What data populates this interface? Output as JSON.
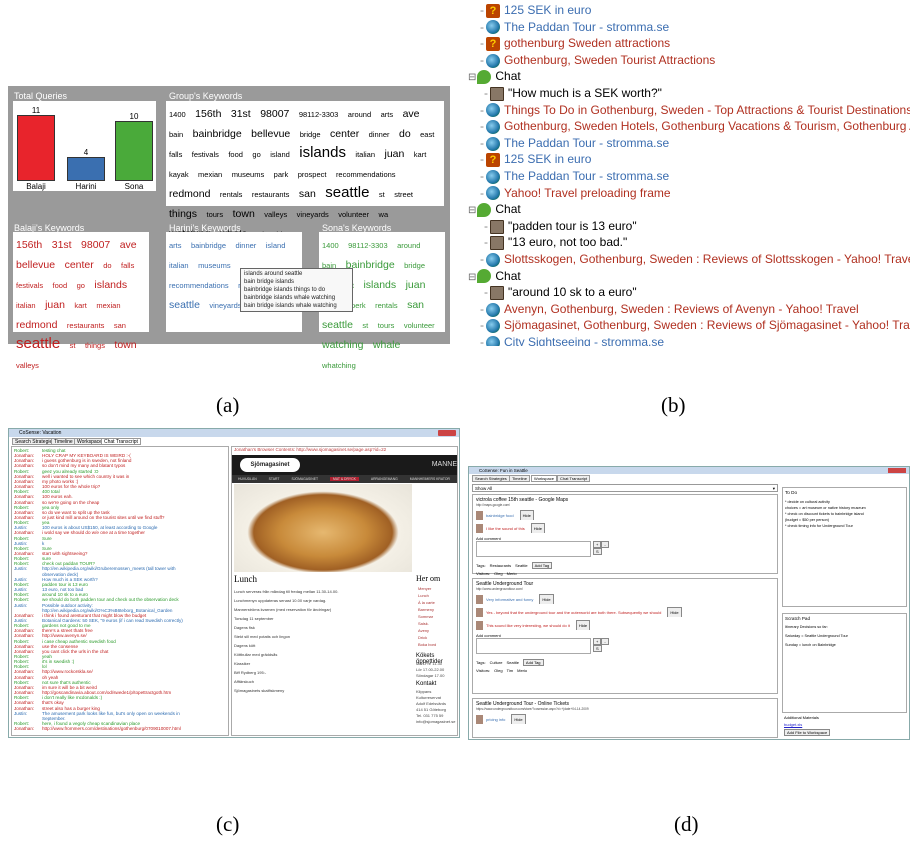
{
  "captions": [
    "(a)",
    "(b)",
    "(c)",
    "(d)"
  ],
  "panel_a": {
    "total_title": "Total Queries",
    "group_title": "Group's Keywords",
    "balaji_title": "Balaji's Keywords",
    "harini_title": "Harini's Keywords",
    "sona_title": "Sona's Keywords",
    "bars": [
      {
        "name": "Balaji",
        "value": "11",
        "color": "#e8242c"
      },
      {
        "name": "Harini",
        "value": "4",
        "color": "#3a6fb0"
      },
      {
        "name": "Sona",
        "value": "10",
        "color": "#4aaa3a"
      }
    ],
    "group_words": [
      "1400",
      "156th",
      "31st",
      "98007",
      "98112-3303",
      "around",
      "arts",
      "ave",
      "bain",
      "bainbridge",
      "bellevue",
      "bridge",
      "center",
      "dinner",
      "do",
      "east",
      "falls",
      "festivals",
      "food",
      "go",
      "island",
      "islands",
      "italian",
      "juan",
      "kart",
      "kayak",
      "mexian",
      "museums",
      "park",
      "prospect",
      "recommendations",
      "redmond",
      "rentals",
      "restaurants",
      "san",
      "seattle",
      "st",
      "street",
      "things",
      "tours",
      "town",
      "valleys",
      "vineyards",
      "volunteer",
      "wa",
      "watching",
      "whale",
      "whatching"
    ],
    "balaji_words": [
      "156th",
      "31st",
      "98007",
      "ave",
      "bellevue",
      "center",
      "do",
      "falls",
      "festivals",
      "food",
      "go",
      "islands",
      "italian",
      "juan",
      "kart",
      "mexian",
      "redmond",
      "restaurants",
      "san",
      "seattle",
      "st",
      "things",
      "town",
      "valleys"
    ],
    "harini_words": [
      "arts",
      "bainbridge",
      "dinner",
      "island",
      "italian",
      "museums",
      "recommendations",
      "restaurants",
      "seattle",
      "vineyards",
      "winery"
    ],
    "sona_words": [
      "1400",
      "98112-3303",
      "around",
      "bain",
      "bainbridge",
      "bridge",
      "do",
      "east",
      "islands",
      "juan",
      "kayak",
      "perk",
      "rentals",
      "san",
      "seattle",
      "st",
      "tours",
      "volunteer",
      "watching",
      "whale",
      "whatching"
    ],
    "tooltip": [
      "islands around seattle",
      "bain bridge islands",
      "bainbridge islands things to do",
      "bainbridge islands whale watching",
      "bain bridge islands whale watching"
    ]
  },
  "panel_b": {
    "rows": [
      {
        "icon": "q",
        "text": "125 SEK in euro",
        "color": "blue",
        "indent": 1
      },
      {
        "icon": "e",
        "text": "The Paddan Tour - stromma.se",
        "color": "blue",
        "indent": 1
      },
      {
        "icon": "q",
        "text": "gothenburg Sweden attractions",
        "color": "red",
        "indent": 1
      },
      {
        "icon": "e",
        "text": "Gothenburg, Sweden Tourist Attractions",
        "color": "red",
        "indent": 1
      },
      {
        "icon": "c",
        "text": "Chat",
        "color": "black",
        "indent": 0
      },
      {
        "icon": "u",
        "text": "\"How much is a SEK worth?\"",
        "color": "black",
        "indent": 2
      },
      {
        "icon": "e",
        "text": "Things To Do in Gothenburg, Sweden - Top Attractions & Tourist Destinations In G",
        "color": "red",
        "indent": 1
      },
      {
        "icon": "e",
        "text": "Gothenburg, Sweden Hotels, Gothenburg Vacations & Tourism, Gothenburg Attra",
        "color": "red",
        "indent": 1
      },
      {
        "icon": "e",
        "text": "The Paddan Tour - stromma.se",
        "color": "blue",
        "indent": 1
      },
      {
        "icon": "q",
        "text": "125 SEK in euro",
        "color": "blue",
        "indent": 1
      },
      {
        "icon": "e",
        "text": "The Paddan Tour - stromma.se",
        "color": "blue",
        "indent": 1
      },
      {
        "icon": "e",
        "text": "Yahoo! Travel preloading frame",
        "color": "red",
        "indent": 1
      },
      {
        "icon": "c",
        "text": "Chat",
        "color": "black",
        "indent": 0
      },
      {
        "icon": "u",
        "text": "\"padden tour is 13 euro\"",
        "color": "black",
        "indent": 2
      },
      {
        "icon": "u",
        "text": "\"13 euro, not too bad.\"",
        "color": "black",
        "indent": 2
      },
      {
        "icon": "e",
        "text": "Slottsskogen, Gothenburg, Sweden : Reviews of Slottsskogen - Yahoo! Travel",
        "color": "red",
        "indent": 1
      },
      {
        "icon": "c",
        "text": "Chat",
        "color": "black",
        "indent": 0
      },
      {
        "icon": "u",
        "text": "\"around 10 sk to a euro\"",
        "color": "black",
        "indent": 2
      },
      {
        "icon": "e",
        "text": "Avenyn, Gothenburg, Sweden : Reviews of Avenyn - Yahoo! Travel",
        "color": "red",
        "indent": 1
      },
      {
        "icon": "e",
        "text": "Sjömagasinet, Gothenburg, Sweden : Reviews of Sjömagasinet - Yahoo! Travel",
        "color": "red",
        "indent": 1
      },
      {
        "icon": "e",
        "text": "City Sightseeing - stromma.se",
        "color": "blue",
        "indent": 1
      }
    ]
  },
  "panel_c": {
    "window_title": "CoSense: Vacation",
    "tabs": [
      "Search Strategies",
      "Timeline",
      "Workspace",
      "Chat Transcript"
    ],
    "browser_label": "Jonathan's Browser Contents: http://www.sjomagasinet.se/page.asp?id=22",
    "site_logo": "Sjömagasinet",
    "site_header_right": "MANNE",
    "nav": [
      "HUVUDLÄN",
      "START",
      "SJÖMAGASINET",
      "MAT & DRYCK",
      "ARRANGEMANG",
      "MANNHEIMERS KRATOR",
      "LED MANNHEIM"
    ],
    "lunch_title": "Lunch",
    "lunch_text": [
      "Lunch serveras från måndag till fredag mellan 11.30-14.00.",
      "Lunchmenyn uppdateras senast 10.00 varje vardag.",
      "Mannerströms kvarnen (med reservation för ändringar)",
      "Torsdag 11 september",
      "Dagens fisk",
      "Stekt sill med potatis och lingon",
      "Dagens kött",
      "Köttbullar med gräddsås",
      "Klassiker",
      "Biff Rydberg 195:-",
      "Afftärskuch",
      "Sjömagasinets skalfiskmeny"
    ],
    "right_title": "Her om",
    "right_items": [
      "Menyer",
      "Lunch",
      "À la carte",
      "Barmeny",
      "Sommar",
      "Salsk.",
      "Aveny",
      "Drick",
      "Boka bord"
    ],
    "kokets_title": "Kökets öppettider",
    "kokets_text": [
      "Mån-Fre 11.30",
      "Lör 17.00-22.00",
      "Söndagar 17.00"
    ],
    "kontakt_title": "Kontakt",
    "kontakt_text": [
      "Klippans Kulturreservat",
      "Adolf Edelsvärds",
      "414 51 Göteborg",
      "Tel. 031 775 59",
      "info@sjomagasinet.se"
    ],
    "chat": [
      {
        "n": "Robert:",
        "m": "testing chat",
        "c": "g"
      },
      {
        "n": "Jonathan:",
        "m": "HOLY CRAP MY KEYBOARD IS WEIRD :-(",
        "c": "r"
      },
      {
        "n": "Jonathan:",
        "m": "i guess gothenburg is in sweden, not finland",
        "c": "r"
      },
      {
        "n": "Jonathan:",
        "m": "so don't mind my many and blatant typos",
        "c": "r"
      },
      {
        "n": "Robert:",
        "m": "geez you already started :O",
        "c": "g"
      },
      {
        "n": "Jonathan:",
        "m": "well i wanted to see which country it was in",
        "c": "r"
      },
      {
        "n": "Jonathan:",
        "m": "my photo works :)",
        "c": "r"
      },
      {
        "n": "Jonathan:",
        "m": "100 euros for the whole trip?",
        "c": "r"
      },
      {
        "n": "Robert:",
        "m": "400 total",
        "c": "g"
      },
      {
        "n": "Jonathan:",
        "m": "100 euros eah.",
        "c": "r"
      },
      {
        "n": "Jonathan:",
        "m": "so we're going on the cheap",
        "c": "r"
      },
      {
        "n": "Robert:",
        "m": "yea only",
        "c": "g"
      },
      {
        "n": "Jonathan:",
        "m": "so do we want to split up the task",
        "c": "r"
      },
      {
        "n": "Jonathan:",
        "m": "or just kind mill around on the tourist sites until we find stuff?",
        "c": "r"
      },
      {
        "n": "Robert:",
        "m": "yea",
        "c": "g"
      },
      {
        "n": "Justin:",
        "m": "100 euros is about US$150, at least according to Google",
        "c": "b"
      },
      {
        "n": "Jonathan:",
        "m": "i wold say we should do w/e one at a time together",
        "c": "r"
      },
      {
        "n": "Robert:",
        "m": "Sure",
        "c": "g"
      },
      {
        "n": "Justin:",
        "m": "k",
        "c": "b"
      },
      {
        "n": "Robert:",
        "m": "Sure",
        "c": "g"
      },
      {
        "n": "Jonathan:",
        "m": "start with sightseeing?",
        "c": "r"
      },
      {
        "n": "Robert:",
        "m": "sure",
        "c": "g"
      },
      {
        "n": "Robert:",
        "m": "check out paddan TOUR?",
        "c": "g"
      },
      {
        "n": "Justin:",
        "m": "http://en.wikipedia.org/wiki/Gruberemossen_meets (tall tower with",
        "c": "b"
      },
      {
        "n": "",
        "m": "observation deck)",
        "c": "b"
      },
      {
        "n": "Justin:",
        "m": "How much is a SEK worth?",
        "c": "b"
      },
      {
        "n": "Robert:",
        "m": "padden tour is 13 euro",
        "c": "g"
      },
      {
        "n": "Justin:",
        "m": "13 euro, not too bad",
        "c": "b"
      },
      {
        "n": "Robert:",
        "m": "around 10 sk to a euro",
        "c": "g"
      },
      {
        "n": "Robert:",
        "m": "we should do both padden tour and check out the observation deck",
        "c": "g"
      },
      {
        "n": "Justin:",
        "m": "Possible outdoor activity:",
        "c": "b"
      },
      {
        "n": "",
        "m": "http://en.wikipedia.org/wiki/G%C3%B6teborg_Botanical_Garden",
        "c": "b"
      },
      {
        "n": "Jonathan:",
        "m": "i think i found aresturant that might blow the budget",
        "c": "r"
      },
      {
        "n": "Justin:",
        "m": "Botanical Gardens: 50 SEK, \"9 euros (if i can read Swedish correctly)",
        "c": "b"
      },
      {
        "n": "Robert:",
        "m": "gardens not good to me",
        "c": "g"
      },
      {
        "n": "Jonathan:",
        "m": "there's a street thats free",
        "c": "r"
      },
      {
        "n": "Jonathan:",
        "m": "http://www.avenyn.se/",
        "c": "r"
      },
      {
        "n": "Robert:",
        "m": "i case cheap authentic swedish food",
        "c": "g"
      },
      {
        "n": "Jonathan:",
        "m": "use the consense",
        "c": "r"
      },
      {
        "n": "Jonathan:",
        "m": "you cant click the urls in the chat",
        "c": "r"
      },
      {
        "n": "Robert:",
        "m": "yeah",
        "c": "g"
      },
      {
        "n": "Robert:",
        "m": "it's in swedish :)",
        "c": "g"
      },
      {
        "n": "Robert:",
        "m": "lol",
        "c": "g"
      },
      {
        "n": "Jonathan:",
        "m": "http://www.rockorskla.se/",
        "c": "r"
      },
      {
        "n": "Jonathan:",
        "m": "oh yeah",
        "c": "r"
      },
      {
        "n": "Robert:",
        "m": "not sure that's authentic",
        "c": "g"
      },
      {
        "n": "Jonathan:",
        "m": "im sure it will be a bit weird",
        "c": "r"
      },
      {
        "n": "Jonathan:",
        "m": "http://goscandinavia.about.com/od/swede1/p/topettractgoth.htm",
        "c": "r"
      },
      {
        "n": "Robert:",
        "m": "i don't really like mcdonalds :)",
        "c": "g"
      },
      {
        "n": "Jonathan:",
        "m": "that's okay",
        "c": "r"
      },
      {
        "n": "Jonathan:",
        "m": "street also has a burger king",
        "c": "r"
      },
      {
        "n": "Justin:",
        "m": "The amusement park looks like fun, but's only open on weekends in",
        "c": "b"
      },
      {
        "n": "",
        "m": "September.",
        "c": "b"
      },
      {
        "n": "Robert:",
        "m": "here, i found a vegoly cheap scandinavian place",
        "c": "g"
      },
      {
        "n": "Jonathan:",
        "m": "http://www.frommers.com/destinations/gothenburg/0709010007.html",
        "c": "r"
      }
    ]
  },
  "panel_d": {
    "window_title": "CoSense: Fun in Seattle",
    "tabs": [
      "Search Strategies",
      "Timeline",
      "Workspace",
      "Chat Transcript"
    ],
    "filter": "Show All",
    "cards": [
      {
        "title": "victrola coffee 15th seattle - Google Maps",
        "url": "http://maps.google.com/",
        "items": [
          {
            "text": "bainbridge food",
            "color": "#3a6fb0",
            "hide": "Hide"
          },
          {
            "text": "I like the sound of this",
            "color": "#c02020",
            "hide": "Hide"
          }
        ],
        "comment_label": "Add comment",
        "tags_label": "Tags:",
        "tags": [
          "Restaurants",
          "Seattle"
        ],
        "add_tag": "Add Tag",
        "visitors_label": "Visitors:",
        "visitors": [
          "Oleg",
          "Merio"
        ]
      },
      {
        "title": "Seattle Underground Tour",
        "url": "http://www.undergroundtour.com/",
        "items": [
          {
            "text": "Very informative and funny",
            "color": "#3a6fb0",
            "hide": "Hide"
          },
          {
            "text": "Yes - beyond that the underground tour and the outerworld are both there. Subsequently we should",
            "color": "#c02020",
            "hide": "Hide"
          },
          {
            "text": "This sound like very interesting, we should do it",
            "color": "#c02020",
            "hide": "Hide"
          }
        ],
        "comment_label": "Add comment",
        "tags_label": "Tags:",
        "tags": [
          "Culture",
          "Seattle"
        ],
        "add_tag": "Add Tag",
        "visitors_label": "Visitors:",
        "visitors": [
          "Oleg",
          "Tim",
          "Merio"
        ]
      },
      {
        "title": "Seattle Underground Tour - Online Tickets",
        "url": "https://www.undergroundtour.com/store/?cosession.aspx?d=+(date+04-14-2009",
        "items": [
          {
            "text": "pricing info",
            "color": "#3a6fb0",
            "hide": "Hide"
          }
        ]
      }
    ],
    "todo_title": "To Do",
    "todo_text": [
      "* decide on cultural activity",
      "choices = art museum or native history museum",
      "* check on discount tickets to bainbridge island",
      "(budget = $50 per person)",
      "* check timing info for Underground Tour"
    ],
    "scratch_title": "Scratch Pad",
    "scratch_text": [
      "Itinerary Decisions so far:",
      "Saturday = Seattle Underground Tour",
      "Sunday = lunch on Bainbridge"
    ],
    "materials_title": "Additional Materials",
    "materials_link": "budget.xls",
    "add_file": "Add File to Workspace",
    "s_btn": "S",
    "plus_btn": "+",
    "minus_btn": "-"
  }
}
